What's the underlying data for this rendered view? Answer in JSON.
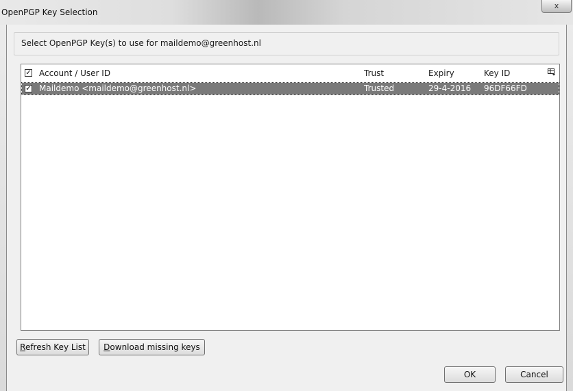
{
  "window": {
    "title": "OpenPGP Key Selection",
    "close_label": "x"
  },
  "prompt": {
    "text": "Select OpenPGP Key(s) to use for maildemo@greenhost.nl"
  },
  "table": {
    "columns": [
      {
        "label": "Account / User ID"
      },
      {
        "label": "Trust"
      },
      {
        "label": "Expiry"
      },
      {
        "label": "Key ID"
      }
    ],
    "column_picker_icon": "column-picker-icon",
    "rows": [
      {
        "checked": true,
        "account": "Maildemo <maildemo@greenhost.nl>",
        "trust": "Trusted",
        "expiry": "29-4-2016",
        "key_id": "96DF66FD"
      }
    ]
  },
  "buttons": {
    "refresh_first": "R",
    "refresh_rest": "efresh Key List",
    "download_first": "D",
    "download_rest": "ownload missing keys",
    "ok": "OK",
    "cancel": "Cancel"
  }
}
